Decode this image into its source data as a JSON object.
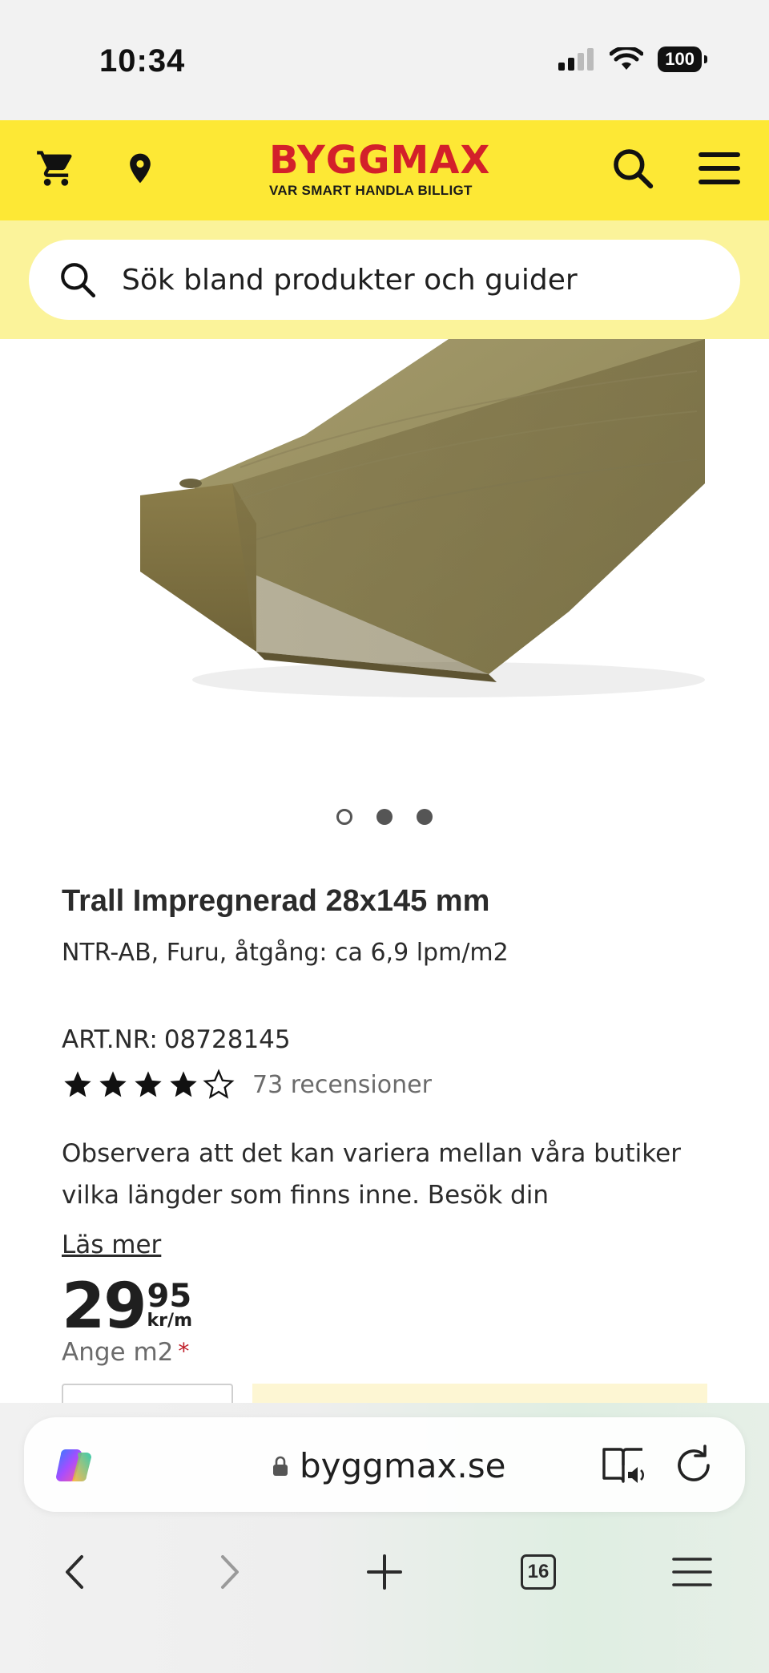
{
  "status_bar": {
    "time": "10:34",
    "battery": "100"
  },
  "header": {
    "logo_text": "BYGGMAX",
    "logo_tagline": "VAR SMART HANDLA BILLIGT",
    "brand_color": "#d3202a",
    "header_color": "#fde835"
  },
  "search": {
    "placeholder": "Sök bland produkter och guider"
  },
  "product": {
    "image_dots": 3,
    "active_dot": 0,
    "title": "Trall Impregnerad 28x145 mm",
    "subtitle": "NTR-AB, Furu, åtgång: ca 6,9 lpm/m2",
    "artnr_label": "ART.NR:",
    "artnr_value": "08728145",
    "rating": 4,
    "rating_max": 5,
    "reviews": "73 recensioner",
    "description": "Observera att det kan variera mellan våra butiker vilka längder som finns inne. Besök din",
    "read_more": "Läs mer",
    "price_integer": "29",
    "price_decimal": "95",
    "price_unit": "kr/m",
    "ange_label": "Ange m2",
    "required_marker": "*"
  },
  "browser": {
    "url": "byggmax.se",
    "tab_count": "16"
  }
}
